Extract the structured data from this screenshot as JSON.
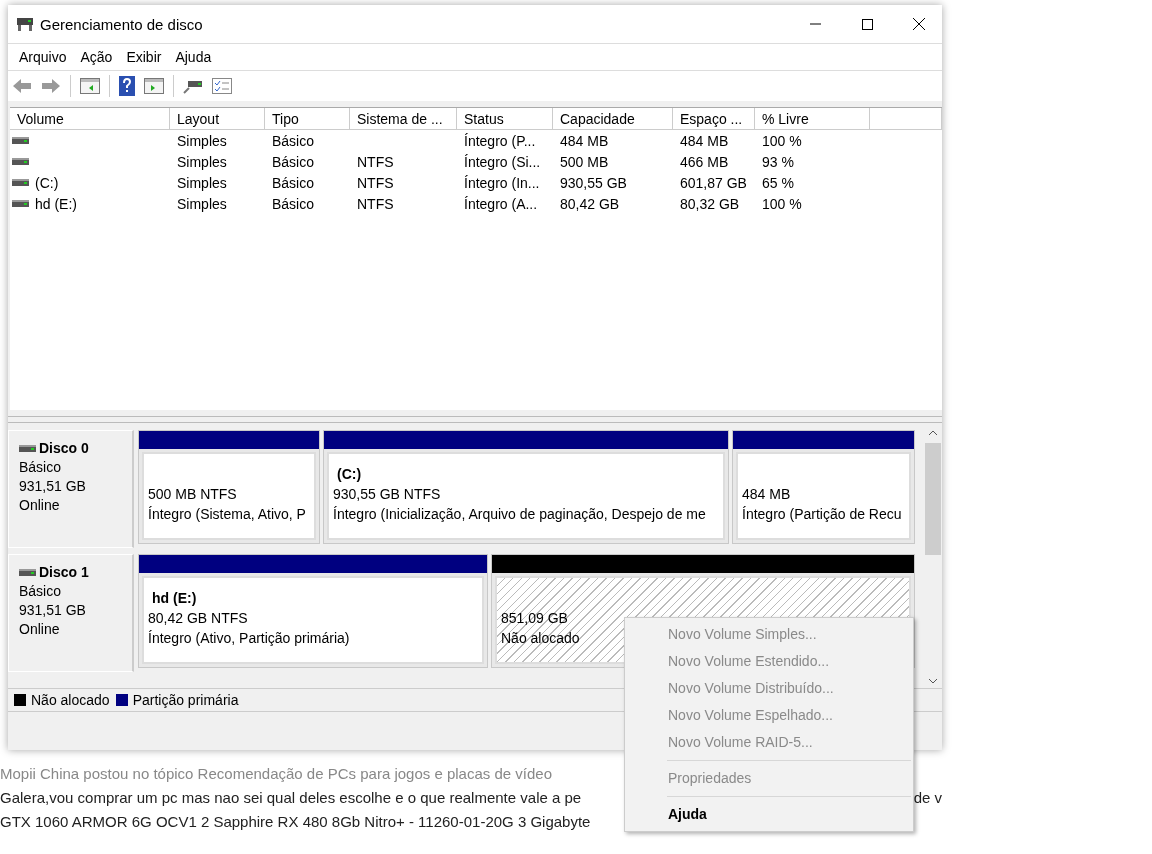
{
  "window": {
    "title": "Gerenciamento de disco"
  },
  "menu_bar": [
    "Arquivo",
    "Ação",
    "Exibir",
    "Ajuda"
  ],
  "table": {
    "columns": [
      "Volume",
      "Layout",
      "Tipo",
      "Sistema de ...",
      "Status",
      "Capacidade",
      "Espaço ...",
      "% Livre"
    ],
    "rows": [
      {
        "layout": "Simples",
        "tipo": "Básico",
        "status": "Íntegro (P...",
        "capacidade": "484 MB",
        "espaco": "484 MB",
        "livre": "100 %"
      },
      {
        "layout": "Simples",
        "tipo": "Básico",
        "sistema": "NTFS",
        "status": "Íntegro (Si...",
        "capacidade": "500 MB",
        "espaco": "466 MB",
        "livre": "93 %"
      },
      {
        "volume": "(C:)",
        "layout": "Simples",
        "tipo": "Básico",
        "sistema": "NTFS",
        "status": "Íntegro (In...",
        "capacidade": "930,55 GB",
        "espaco": "601,87 GB",
        "livre": "65 %"
      },
      {
        "volume": "hd (E:)",
        "layout": "Simples",
        "tipo": "Básico",
        "sistema": "NTFS",
        "status": "Íntegro (A...",
        "capacidade": "80,42 GB",
        "espaco": "80,32 GB",
        "livre": "100 %"
      }
    ]
  },
  "disks": [
    {
      "name": "Disco 0",
      "type": "Básico",
      "size": "931,51 GB",
      "state": "Online",
      "partitions": [
        {
          "kind": "primary",
          "size_fs": "500 MB NTFS",
          "status": "Íntegro (Sistema, Ativo, P"
        },
        {
          "kind": "primary",
          "name": "(C:)",
          "size_fs": "930,55 GB NTFS",
          "status": "Íntegro (Inicialização, Arquivo de paginação, Despejo de me"
        },
        {
          "kind": "primary",
          "size_fs": "484 MB",
          "status": "Íntegro (Partição de Recu"
        }
      ]
    },
    {
      "name": "Disco 1",
      "type": "Básico",
      "size": "931,51 GB",
      "state": "Online",
      "partitions": [
        {
          "kind": "primary",
          "name": "hd  (E:)",
          "size_fs": "80,42 GB NTFS",
          "status": "Íntegro (Ativo, Partição primária)"
        },
        {
          "kind": "unallocated",
          "size_fs": "851,09 GB",
          "status": "Não alocado"
        }
      ]
    }
  ],
  "legend": [
    {
      "label": "Não alocado",
      "color": "#000000"
    },
    {
      "label": "Partição primária",
      "color": "#000080"
    }
  ],
  "context_menu": [
    {
      "kind": "item",
      "label": "Novo Volume Simples...",
      "disabled": true,
      "default": false
    },
    {
      "kind": "item",
      "label": "Novo Volume Estendido...",
      "disabled": true,
      "default": false
    },
    {
      "kind": "item",
      "label": "Novo Volume Distribuído...",
      "disabled": true,
      "default": false
    },
    {
      "kind": "item",
      "label": "Novo Volume Espelhado...",
      "disabled": true,
      "default": false
    },
    {
      "kind": "item",
      "label": "Novo Volume RAID-5...",
      "disabled": true,
      "default": false
    },
    {
      "kind": "separator"
    },
    {
      "kind": "item",
      "label": "Propriedades",
      "disabled": true,
      "default": false
    },
    {
      "kind": "separator"
    },
    {
      "kind": "item",
      "label": "Ajuda",
      "disabled": false,
      "default": true
    }
  ],
  "background_page": {
    "byline": "Mopii China postou no tópico Recomendação de PCs para jogos e placas de vídeo",
    "lines": [
      {
        "left": "Galera,vou comprar um pc mas nao sei qual deles escolhe e o que realmente vale a pe",
        "right": "de v"
      },
      {
        "left": "GTX 1060 ARMOR 6G OCV1 2 Sapphire RX 480 8Gb Nitro+ - 11260-01-20G 3 Gigabyte"
      }
    ]
  }
}
